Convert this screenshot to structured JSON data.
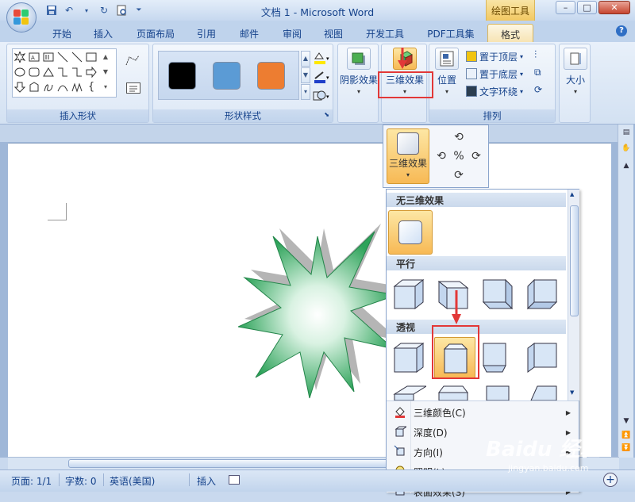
{
  "window": {
    "title": "文档 1 - Microsoft Word",
    "contextual_tab_header": "绘图工具",
    "controls": {
      "minimize": "–",
      "maximize": "□",
      "close": "✕"
    }
  },
  "tabs": [
    "开始",
    "插入",
    "页面布局",
    "引用",
    "邮件",
    "审阅",
    "视图",
    "开发工具",
    "PDF工具集",
    "格式"
  ],
  "active_tab": "格式",
  "ribbon": {
    "groups": {
      "insert_shapes": "插入形状",
      "shape_styles": "形状样式",
      "arrange": "排列"
    },
    "shape_style_swatches": [
      "#000000",
      "#5b9bd5",
      "#ed7d31"
    ],
    "buttons": {
      "shadow_effects": "阴影效果",
      "three_d_effects": "三维效果",
      "position": "位置",
      "bring_to_front": "置于顶层",
      "send_to_back": "置于底层",
      "text_wrapping": "文字环绕",
      "size": "大小"
    }
  },
  "dropdown": {
    "big_button": "三维效果",
    "sections": {
      "none": "无三维效果",
      "parallel": "平行",
      "perspective": "透视"
    },
    "menu_items": [
      {
        "label": "三维颜色(C)",
        "icon": "paint-bucket-icon"
      },
      {
        "label": "深度(D)",
        "icon": "depth-icon"
      },
      {
        "label": "方向(I)",
        "icon": "direction-icon"
      },
      {
        "label": "照明(L)",
        "icon": "lightbulb-icon"
      },
      {
        "label": "表面效果(S)",
        "icon": "surface-icon"
      }
    ]
  },
  "statusbar": {
    "page": "页面: 1/1",
    "words": "字数: 0",
    "language": "英语(美国)",
    "mode": "插入"
  },
  "watermark": {
    "brand": "Baidu 经验",
    "url": "jingyan.baidu.com"
  },
  "colors": {
    "highlight_red": "#e23838",
    "star_green": "#2ea35a",
    "active_orange": "#f7b955"
  }
}
